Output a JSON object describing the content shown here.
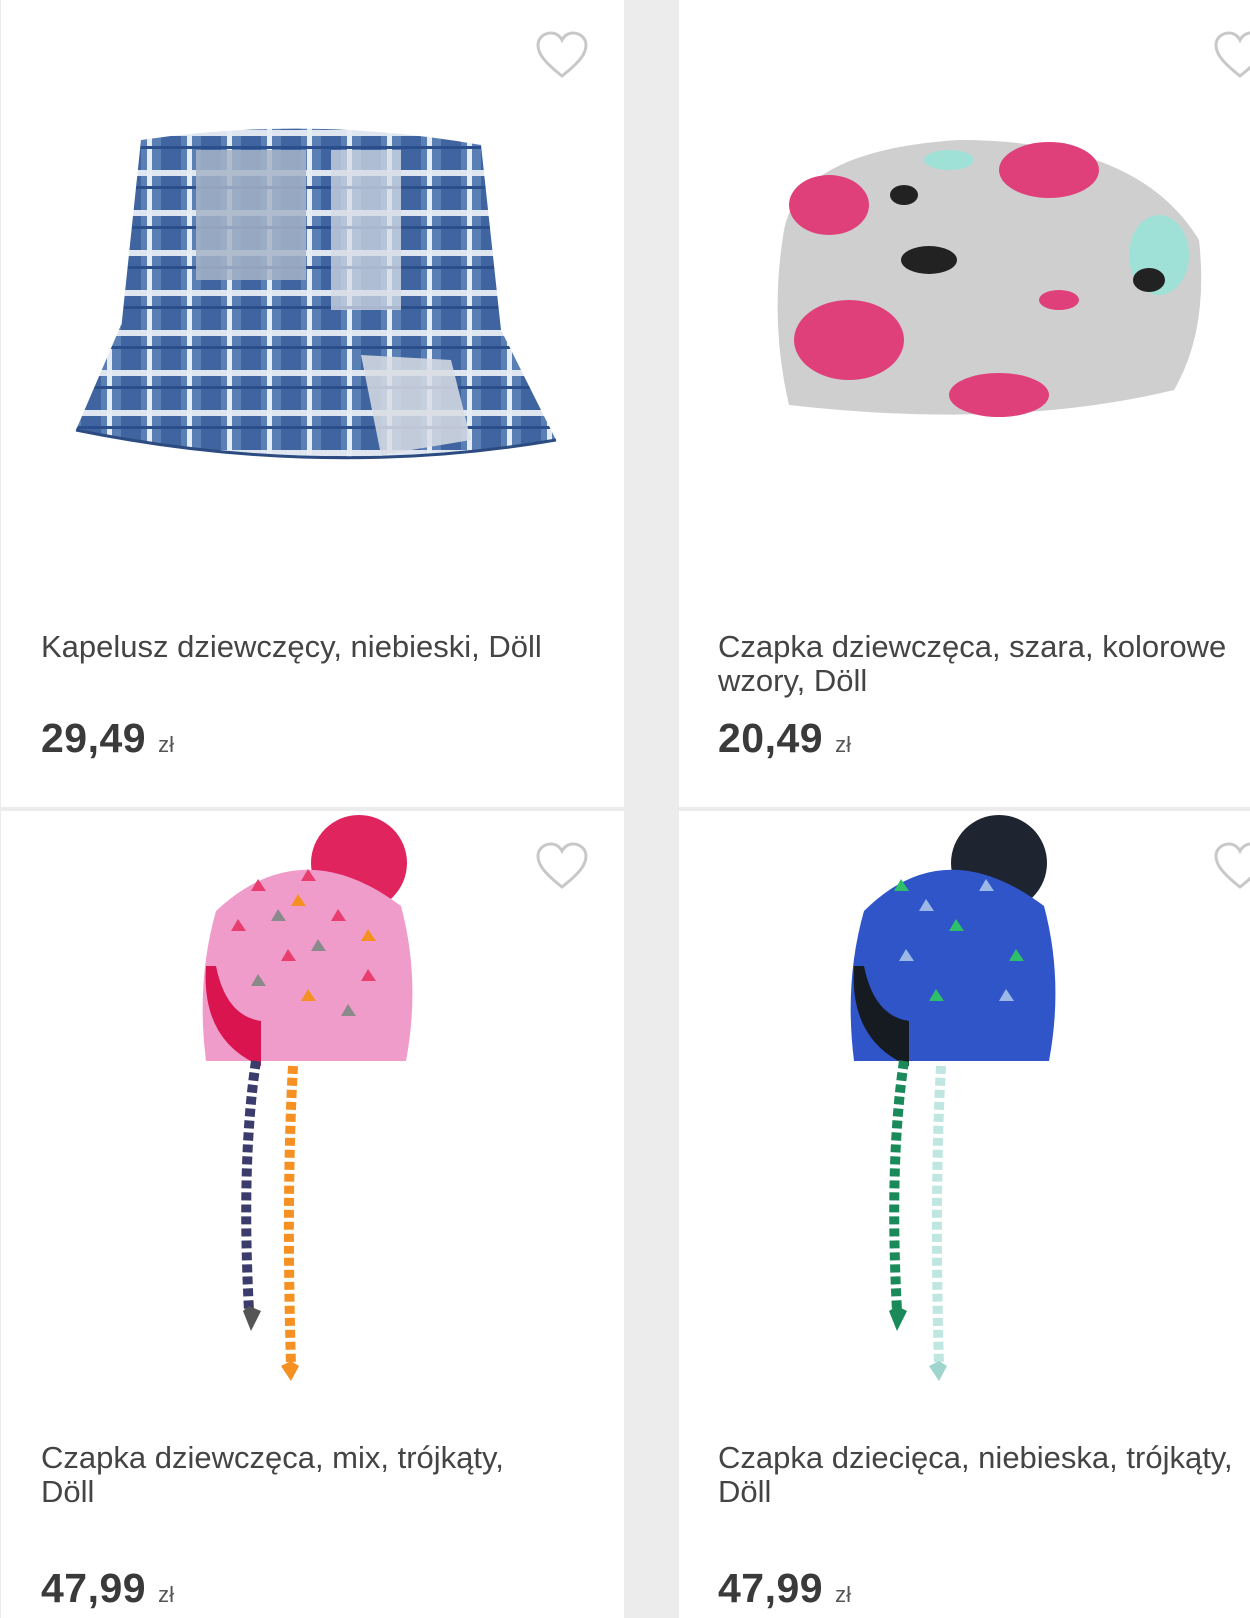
{
  "products": [
    {
      "title": "Kapelusz dziewczęcy, niebieski, Döll",
      "price": "29,49",
      "currency": "zł",
      "image_icon": "bucket-hat-image"
    },
    {
      "title": "Czapka dziewczęca, szara, kolorowe wzory, Döll",
      "price": "20,49",
      "currency": "zł",
      "image_icon": "beanie-image"
    },
    {
      "title": "Czapka dziewczęca, mix, trójkąty, Döll",
      "price": "47,99",
      "currency": "zł",
      "image_icon": "pompom-hat-image"
    },
    {
      "title": "Czapka dziecięca, niebieska, trójkąty, Döll",
      "price": "47,99",
      "currency": "zł",
      "image_icon": "pompom-hat-image"
    }
  ],
  "favorite_icon": "heart-outline-icon",
  "colors": {
    "background": "#ececec",
    "card": "#ffffff",
    "text": "#3c3c3c",
    "icon": "#c8c8c8"
  }
}
